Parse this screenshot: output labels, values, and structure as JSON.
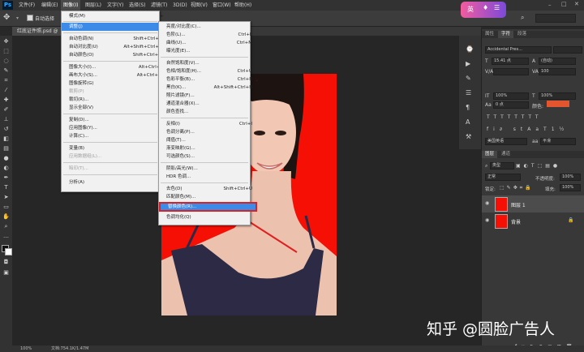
{
  "app": {
    "logo": "Ps"
  },
  "menubar": {
    "items": [
      "文件(F)",
      "编辑(E)",
      "图像(I)",
      "图层(L)",
      "文字(Y)",
      "选择(S)",
      "滤镜(T)",
      "3D(D)",
      "视图(V)",
      "窗口(W)",
      "帮助(H)"
    ]
  },
  "options": {
    "auto_select_label": "自动选择"
  },
  "document": {
    "tab_label": "红底证件照.psd @"
  },
  "status": {
    "zoom": "100%",
    "doc_info": "文档:754.1K/1.47M"
  },
  "image_menu": {
    "items": [
      {
        "label": "模式(M)",
        "submenu": true
      },
      {
        "label": "调整(J)",
        "submenu": true,
        "highlight": true
      },
      {
        "label": "自动色调(N)",
        "shortcut": "Shift+Ctrl+L"
      },
      {
        "label": "自动对比度(U)",
        "shortcut": "Alt+Shift+Ctrl+L"
      },
      {
        "label": "自动颜色(O)",
        "shortcut": "Shift+Ctrl+B"
      },
      {
        "label": "图像大小(I)...",
        "shortcut": "Alt+Ctrl+I"
      },
      {
        "label": "画布大小(S)...",
        "shortcut": "Alt+Ctrl+C"
      },
      {
        "label": "图像旋转(G)",
        "submenu": true
      },
      {
        "label": "裁剪(P)",
        "disabled": true
      },
      {
        "label": "裁切(R)..."
      },
      {
        "label": "显示全部(V)"
      },
      {
        "label": "复制(D)..."
      },
      {
        "label": "应用图像(Y)..."
      },
      {
        "label": "计算(C)..."
      },
      {
        "label": "变量(B)",
        "submenu": true
      },
      {
        "label": "应用数据组(L)...",
        "disabled": true
      },
      {
        "label": "陷印(T)...",
        "disabled": true
      },
      {
        "label": "分析(A)",
        "submenu": true
      }
    ]
  },
  "adjust_menu": {
    "items": [
      {
        "label": "亮度/对比度(C)..."
      },
      {
        "label": "色阶(L)...",
        "shortcut": "Ctrl+L"
      },
      {
        "label": "曲线(U)...",
        "shortcut": "Ctrl+M"
      },
      {
        "label": "曝光度(E)..."
      },
      {
        "label": "自然饱和度(V)..."
      },
      {
        "label": "色相/饱和度(H)...",
        "shortcut": "Ctrl+U"
      },
      {
        "label": "色彩平衡(B)...",
        "shortcut": "Ctrl+B"
      },
      {
        "label": "黑白(K)...",
        "shortcut": "Alt+Shift+Ctrl+B"
      },
      {
        "label": "照片滤镜(F)..."
      },
      {
        "label": "通道混合器(X)..."
      },
      {
        "label": "颜色查找..."
      },
      {
        "label": "反相(I)",
        "shortcut": "Ctrl+I"
      },
      {
        "label": "色调分离(P)..."
      },
      {
        "label": "阈值(T)..."
      },
      {
        "label": "渐变映射(G)..."
      },
      {
        "label": "可选颜色(S)..."
      },
      {
        "label": "阴影/高光(W)..."
      },
      {
        "label": "HDR 色调..."
      },
      {
        "label": "去色(D)",
        "shortcut": "Shift+Ctrl+U"
      },
      {
        "label": "匹配颜色(M)..."
      },
      {
        "label": "替换颜色(R)...",
        "highlight": true
      },
      {
        "label": "色调均化(Q)"
      }
    ]
  },
  "right_panel": {
    "top_tabs": [
      "属性",
      "字符",
      "段落"
    ],
    "font_family": "Accidental Pres...",
    "font_size": "15.41 点",
    "leading": "(自动)",
    "tracking": "100",
    "scale_v": "100%",
    "scale_h": "100%",
    "baseline": "0 点",
    "color_label": "颜色:",
    "language": "美国英语",
    "antialias": "平滑",
    "layer_tabs": [
      "图层",
      "通道"
    ],
    "layer_filter": "类型",
    "blend_mode": "正常",
    "opacity_label": "不透明度:",
    "opacity": "100%",
    "lock_label": "锁定:",
    "fill_label": "填充:",
    "fill": "100%",
    "layers": [
      {
        "name": "图层 1"
      },
      {
        "name": "背景"
      }
    ]
  },
  "ime_badge": {
    "label": "英"
  },
  "watermark": {
    "text": "知乎 @圆脸广告人"
  },
  "colors": {
    "photo_bg": "#f50f05",
    "highlight": "#3d8be8",
    "annotation": "#e02020",
    "swatch": "#e2552f"
  }
}
